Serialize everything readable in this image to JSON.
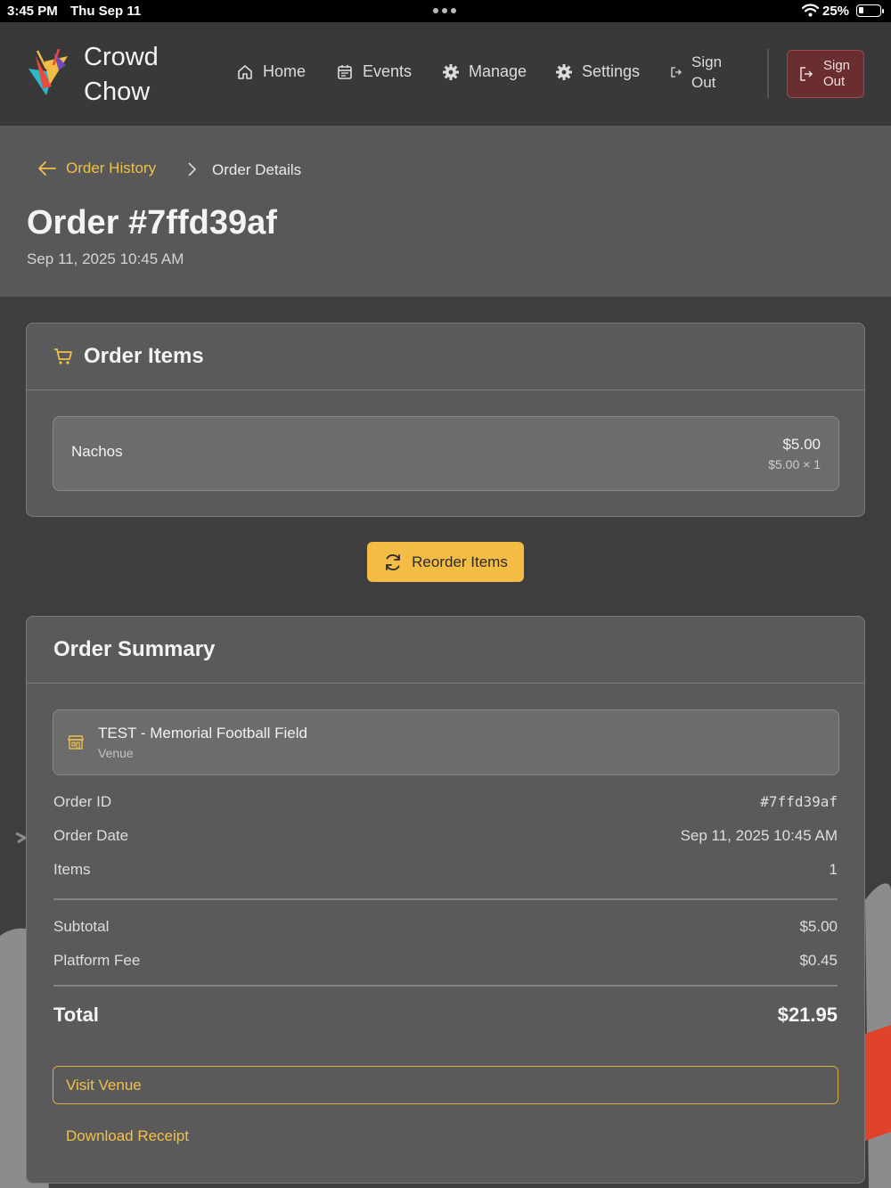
{
  "status_bar": {
    "time": "3:45 PM",
    "date": "Thu Sep 11",
    "battery": "25%"
  },
  "brand": {
    "line1": "Crowd",
    "line2": "Chow"
  },
  "nav": {
    "home": "Home",
    "events": "Events",
    "manage": "Manage",
    "settings": "Settings",
    "sign_out_line1": "Sign",
    "sign_out_line2": "Out",
    "sign_out_button_line1": "Sign",
    "sign_out_button_line2": "Out"
  },
  "breadcrumb": {
    "back": "Order History",
    "current": "Order Details"
  },
  "order": {
    "title": "Order #7ffd39af",
    "date": "Sep 11, 2025 10:45 AM"
  },
  "items_card": {
    "title": "Order Items",
    "items": [
      {
        "name": "Nachos",
        "price": "$5.00",
        "unit_qty": "$5.00 × 1"
      }
    ]
  },
  "reorder_label": "Reorder Items",
  "summary": {
    "title": "Order Summary",
    "venue_name": "TEST - Memorial Football Field",
    "venue_label": "Venue",
    "order_id_label": "Order ID",
    "order_id": "#7ffd39af",
    "order_date_label": "Order Date",
    "order_date": "Sep 11, 2025 10:45 AM",
    "items_label": "Items",
    "items_count": "1",
    "subtotal_label": "Subtotal",
    "subtotal": "$5.00",
    "fee_label": "Platform Fee",
    "fee": "$0.45",
    "total_label": "Total",
    "total": "$21.95",
    "visit_label": "Visit Venue",
    "download_label": "Download Receipt"
  },
  "colors": {
    "accent": "#f3bc45",
    "sign_out_bg": "#6a2e31",
    "background": "#3f3e3e"
  }
}
